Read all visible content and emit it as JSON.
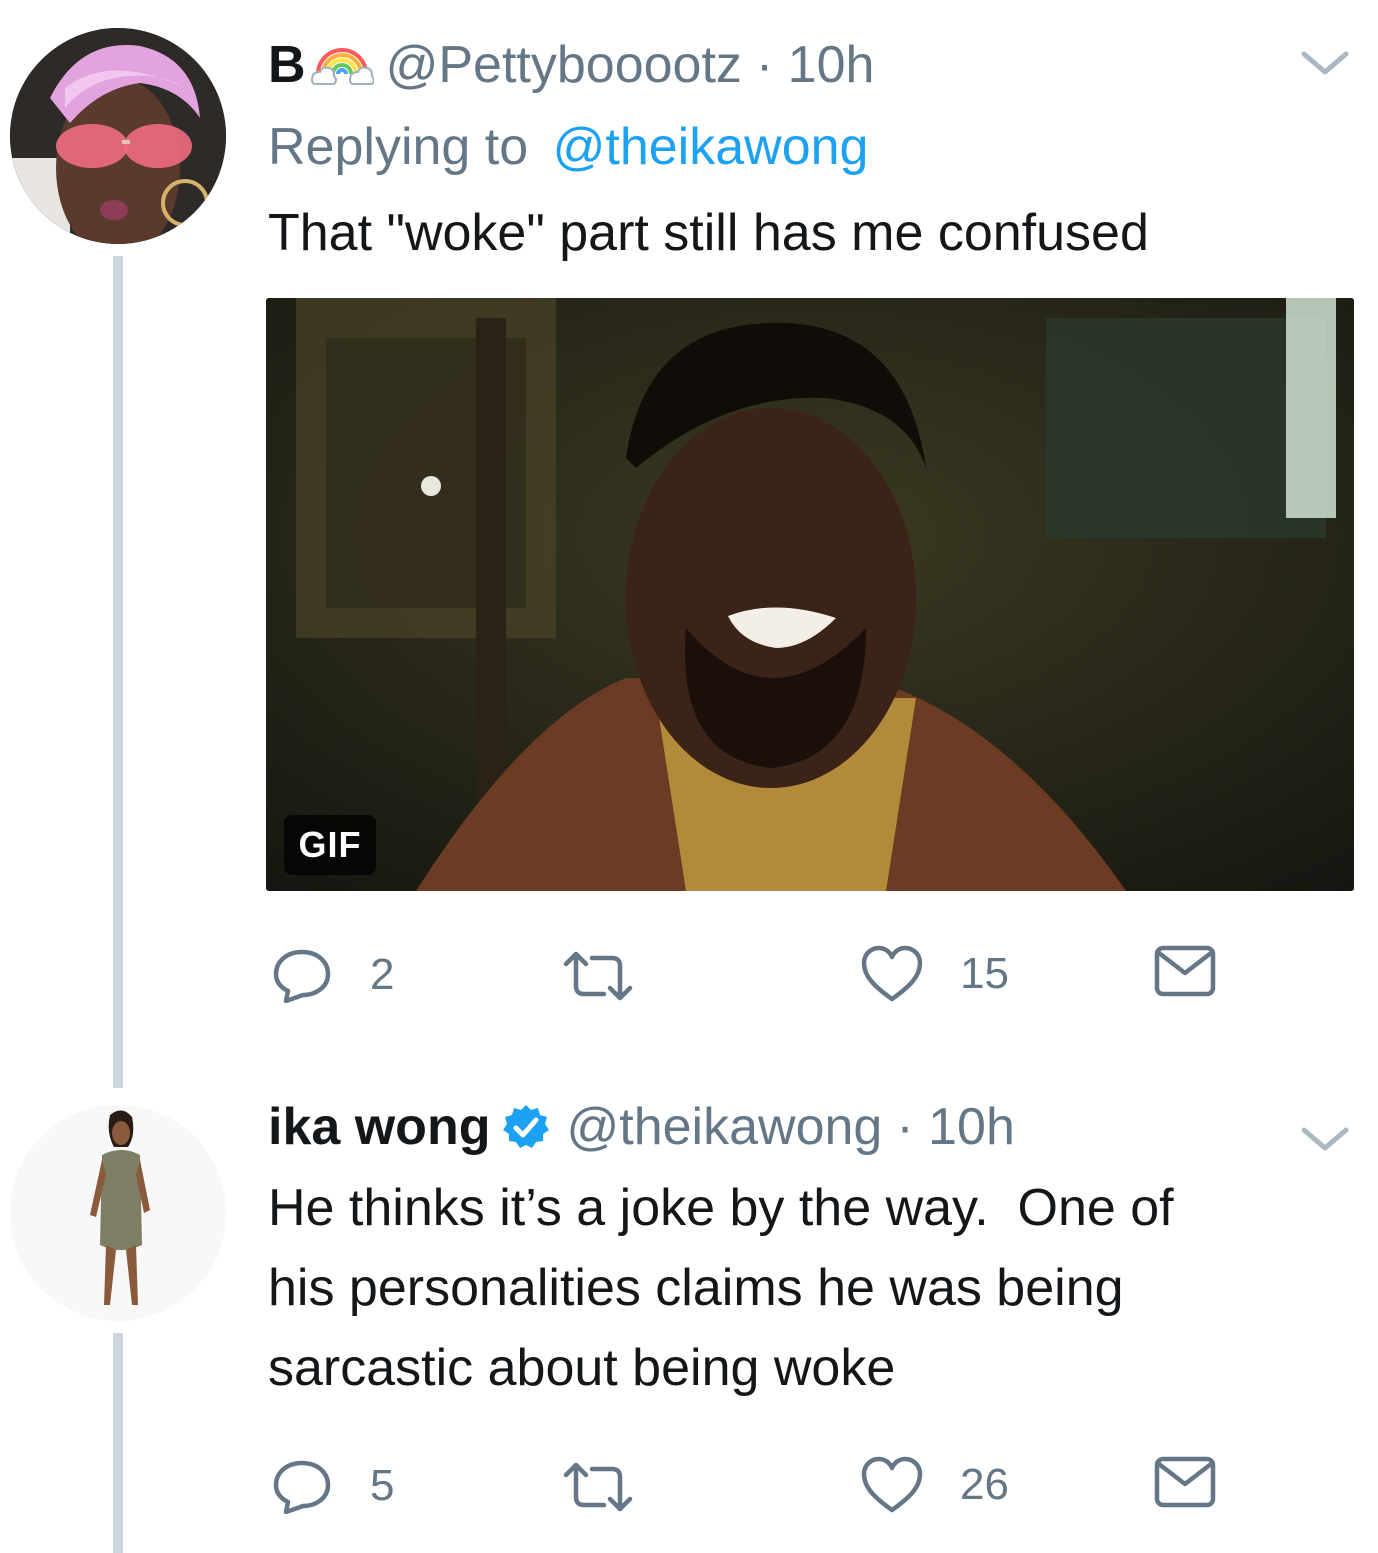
{
  "tweets": [
    {
      "display_name": "B",
      "handle": "@Pettybooootz",
      "time": "· 10h",
      "replying_label": "Replying to",
      "replying_handle": "@theikawong",
      "text": "That \"woke\" part still has me confused",
      "media_badge": "GIF",
      "counts": {
        "replies": "2",
        "retweets": "",
        "likes": "15"
      }
    },
    {
      "display_name": "ika wong",
      "verified": true,
      "handle": "@theikawong",
      "time": "· 10h",
      "text_lines": [
        "He thinks it’s a joke by the way.  One of",
        "his personalities claims he was being",
        "sarcastic about being woke"
      ],
      "counts": {
        "replies": "5",
        "retweets": "",
        "likes": "26"
      }
    }
  ],
  "colors": {
    "text": "#14171a",
    "secondary": "#657786",
    "link": "#1da1f2",
    "thread_line": "#ccd6dd"
  },
  "icons": [
    "chevron-down-icon",
    "rainbow-cloud-emoji",
    "verified-badge-icon",
    "reply-icon",
    "retweet-icon",
    "like-icon",
    "direct-message-icon"
  ]
}
